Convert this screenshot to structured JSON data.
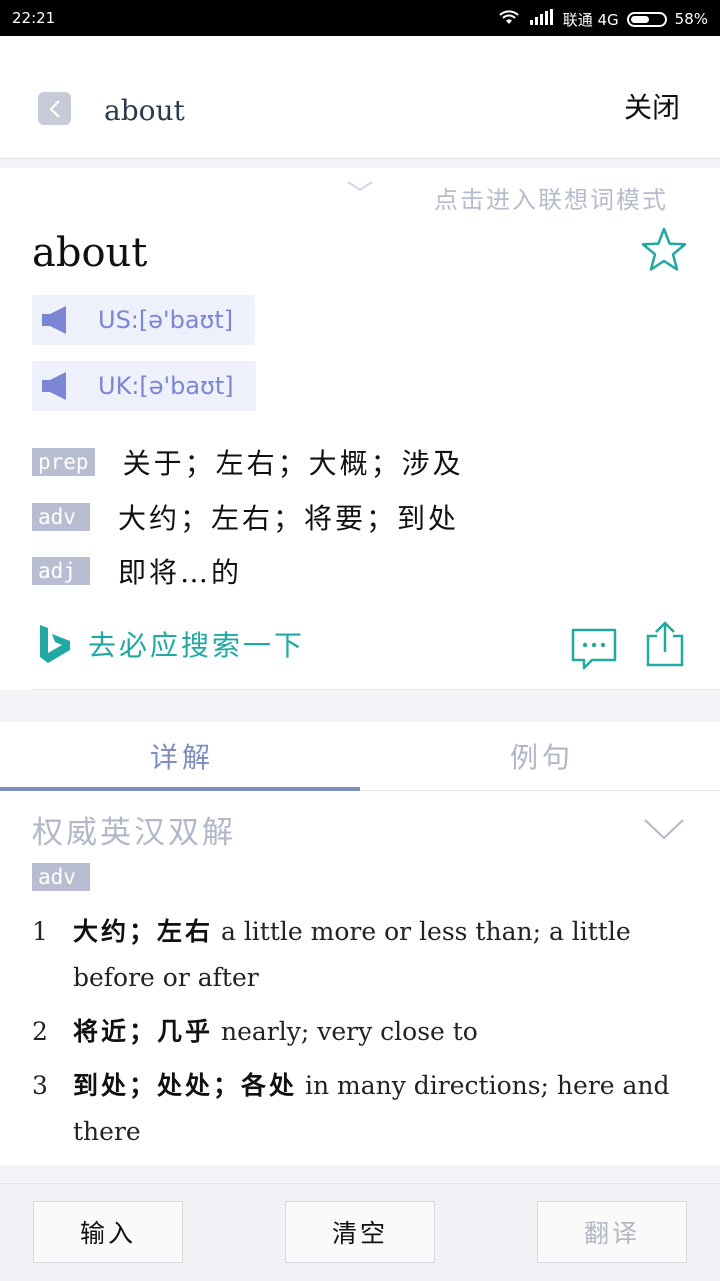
{
  "status_bar": {
    "time": "22:21",
    "carrier": "联通 4G",
    "battery": "58%",
    "battery_level": 0.58
  },
  "header": {
    "query": "about",
    "close_label": "关闭"
  },
  "word_card": {
    "hint": "点击进入联想词模式",
    "headword": "about",
    "pronunciations": [
      {
        "label": "US:[ə'baʊt]"
      },
      {
        "label": "UK:[ə'baʊt]"
      }
    ],
    "definitions": [
      {
        "pos": "prep",
        "text": "关于；左右；大概；涉及"
      },
      {
        "pos": "adv",
        "text": "大约；左右；将要；到处"
      },
      {
        "pos": "adj",
        "text": "即将…的"
      }
    ],
    "bing_search_label": "去必应搜索一下"
  },
  "tabs": [
    {
      "label": "详解"
    },
    {
      "label": "例句"
    }
  ],
  "detail": {
    "section_title": "权威英汉双解",
    "pos": "adv",
    "senses": [
      {
        "num": "1",
        "zh": "大约；左右",
        "en": " a little more or less than; a little before or after"
      },
      {
        "num": "2",
        "zh": "将近；几乎",
        "en": " nearly; very close to"
      },
      {
        "num": "3",
        "zh": "到处；处处；各处",
        "en": " in many directions; here and there"
      }
    ]
  },
  "bottom_bar": {
    "input_label": "输入",
    "clear_label": "清空",
    "translate_label": "翻译"
  },
  "colors": {
    "accent_teal": "#20a8a2",
    "tab_active": "#7e8ec0",
    "pos_tag_bg": "#b9bdd2",
    "pron_bg": "#eef0fb"
  }
}
